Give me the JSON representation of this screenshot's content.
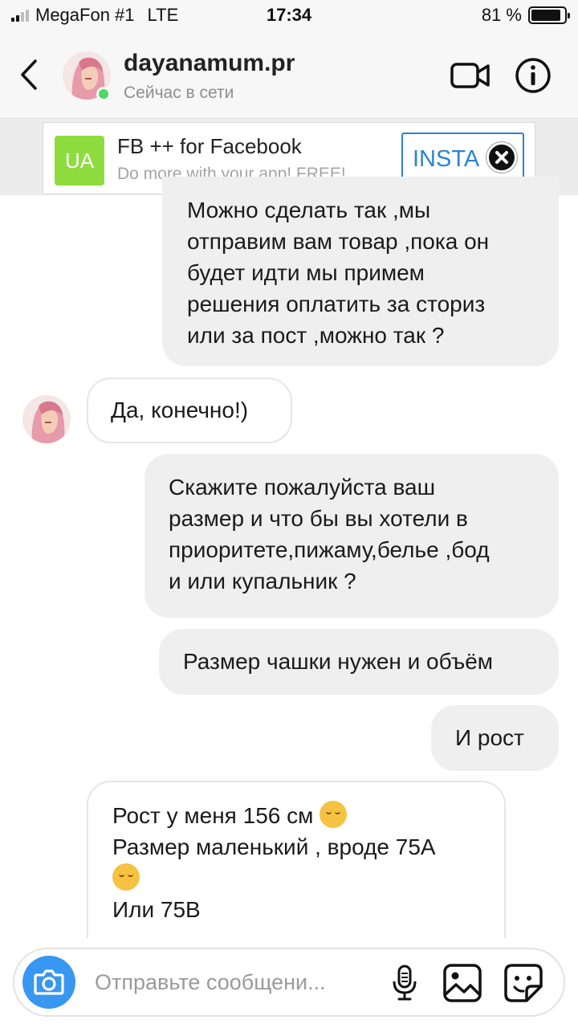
{
  "status_bar": {
    "carrier": "MegaFon #1",
    "network": "LTE",
    "time": "17:34",
    "battery": "81 %",
    "battery_level": 0.81
  },
  "header": {
    "username": "dayanamum.pr",
    "status": "Сейчас в сети",
    "online_color": "#4cd964"
  },
  "ad": {
    "logo_text": "UA",
    "title": "FB ++ for Facebook",
    "subtitle": "Do more with your app! FREE!",
    "button_label": "INSTA",
    "accent": "#2c83d4",
    "logo_color": "#8fdc3f"
  },
  "messages": [
    {
      "direction": "outgoing",
      "text": "Можно сделать так ,мы\nотправим вам товар ,пока он\nбудет идти мы примем\nрешения оплатить за сториз\nили за пост ,можно так ?"
    },
    {
      "direction": "incoming",
      "text": "Да, конечно!)"
    },
    {
      "direction": "outgoing",
      "text": "Скажите пожалуйста ваш\nразмер и что бы вы хотели в\nприоритете,пижаму,белье ,бод\nи или купальник ?"
    },
    {
      "direction": "outgoing",
      "text": "Размер чашки нужен и объём"
    },
    {
      "direction": "outgoing",
      "text": "И рост"
    },
    {
      "direction": "incoming",
      "line1": "Рост у меня 156 см",
      "line2": "Размер маленький , вроде 75А",
      "line3": "Или 75В",
      "emoji1": "smiling-face-icon",
      "emoji2": "thinking-face-icon"
    }
  ],
  "composer": {
    "placeholder": "Отправьте сообщени...",
    "accent": "#3897f0"
  }
}
